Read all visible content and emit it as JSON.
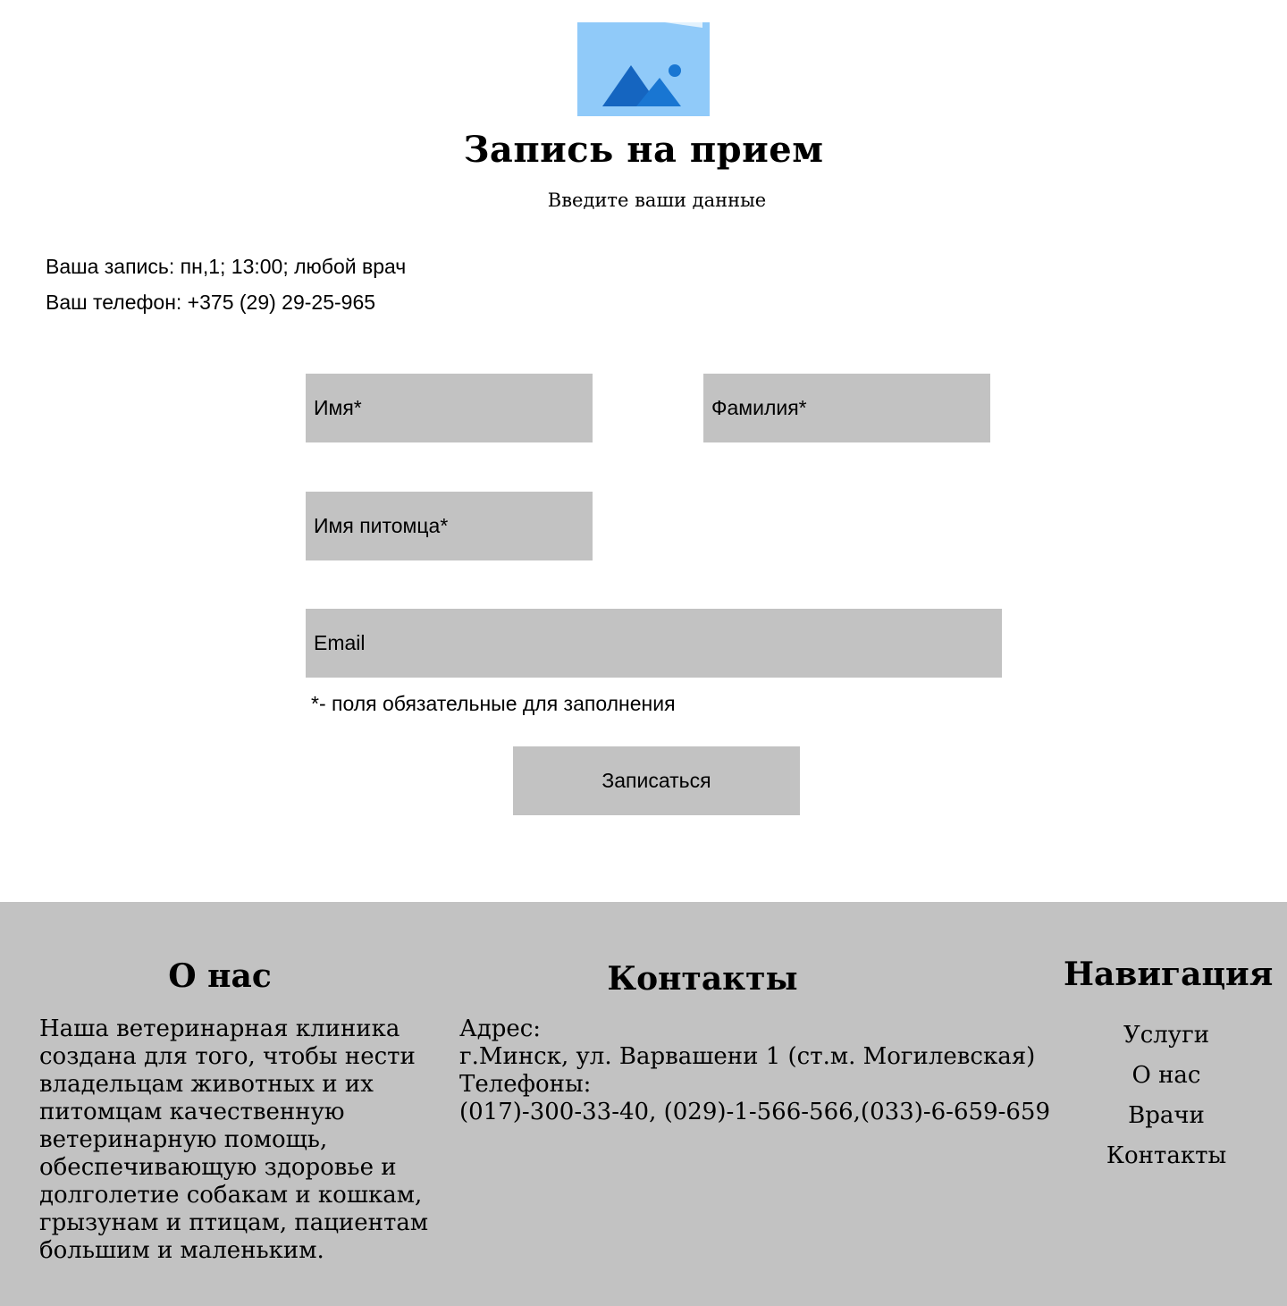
{
  "header": {
    "logo_icon": "image-placeholder-icon",
    "title": "Запись на прием",
    "subtitle": "Введите ваши данные"
  },
  "booking": {
    "appointment": "Ваша запись: пн,1; 13:00; любой врач",
    "phone": "Ваш телефон: +375 (29) 29-25-965"
  },
  "form": {
    "first_name_placeholder": "Имя*",
    "last_name_placeholder": "Фамилия*",
    "pet_name_placeholder": "Имя питомца*",
    "email_placeholder": "Email",
    "required_note": "*- поля обязательные для заполнения",
    "submit_label": "Записаться"
  },
  "footer": {
    "about": {
      "heading": "О нас",
      "text": "Наша ветеринарная клиника создана для того, чтобы нести владельцам животных и их питомцам качественную ветеринарную помощь, обеспечивающую здоровье и долголетие собакам и кошкам, грызунам и птицам, пациентам большим и маленьким."
    },
    "contacts": {
      "heading": "Контакты",
      "address_label": "Адрес:",
      "address": "г.Минск, ул. Варвашени 1 (ст.м. Могилевская)",
      "phones_label": "Телефоны:",
      "phones": "(017)-300-33-40, (029)-1-566-566,(033)-6-659-659"
    },
    "navigation": {
      "heading": "Навигация",
      "items": [
        "Услуги",
        "О нас",
        "Врачи",
        "Контакты"
      ]
    }
  },
  "colors": {
    "field_bg": "#c2c2c2",
    "footer_bg": "#c2c2c2",
    "logo_bg": "#90caf9",
    "logo_mountain_dark": "#1565c0",
    "logo_mountain_light": "#1976d2"
  }
}
